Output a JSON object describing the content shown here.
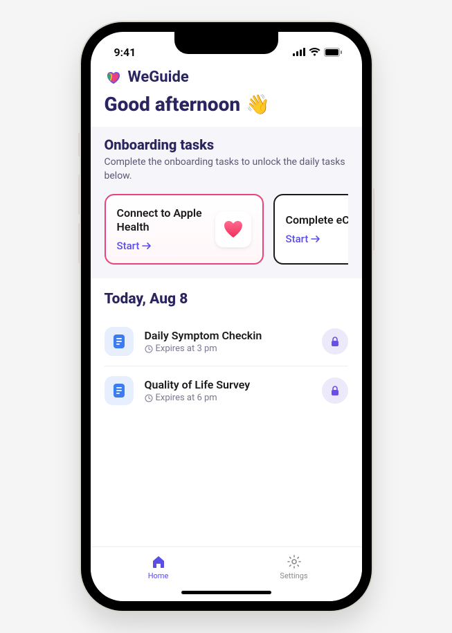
{
  "status": {
    "time": "9:41"
  },
  "app": {
    "name": "WeGuide"
  },
  "greeting": {
    "text": "Good afternoon",
    "emoji": "👋"
  },
  "onboarding": {
    "title": "Onboarding tasks",
    "description": "Complete the onboarding tasks to unlock the daily tasks below.",
    "cards": [
      {
        "title": "Connect to Apple Health",
        "action": "Start"
      },
      {
        "title": "Complete eConsent",
        "action": "Start"
      }
    ]
  },
  "today": {
    "title": "Today, Aug 8",
    "tasks": [
      {
        "title": "Daily Symptom Checkin",
        "expires": "Expires at 3 pm"
      },
      {
        "title": "Quality of Life Survey",
        "expires": "Expires at 6 pm"
      }
    ]
  },
  "tabs": {
    "home": "Home",
    "settings": "Settings"
  },
  "colors": {
    "accent": "#5b4ee6",
    "heading": "#2a2560",
    "cardBorder": "#e8437a"
  }
}
